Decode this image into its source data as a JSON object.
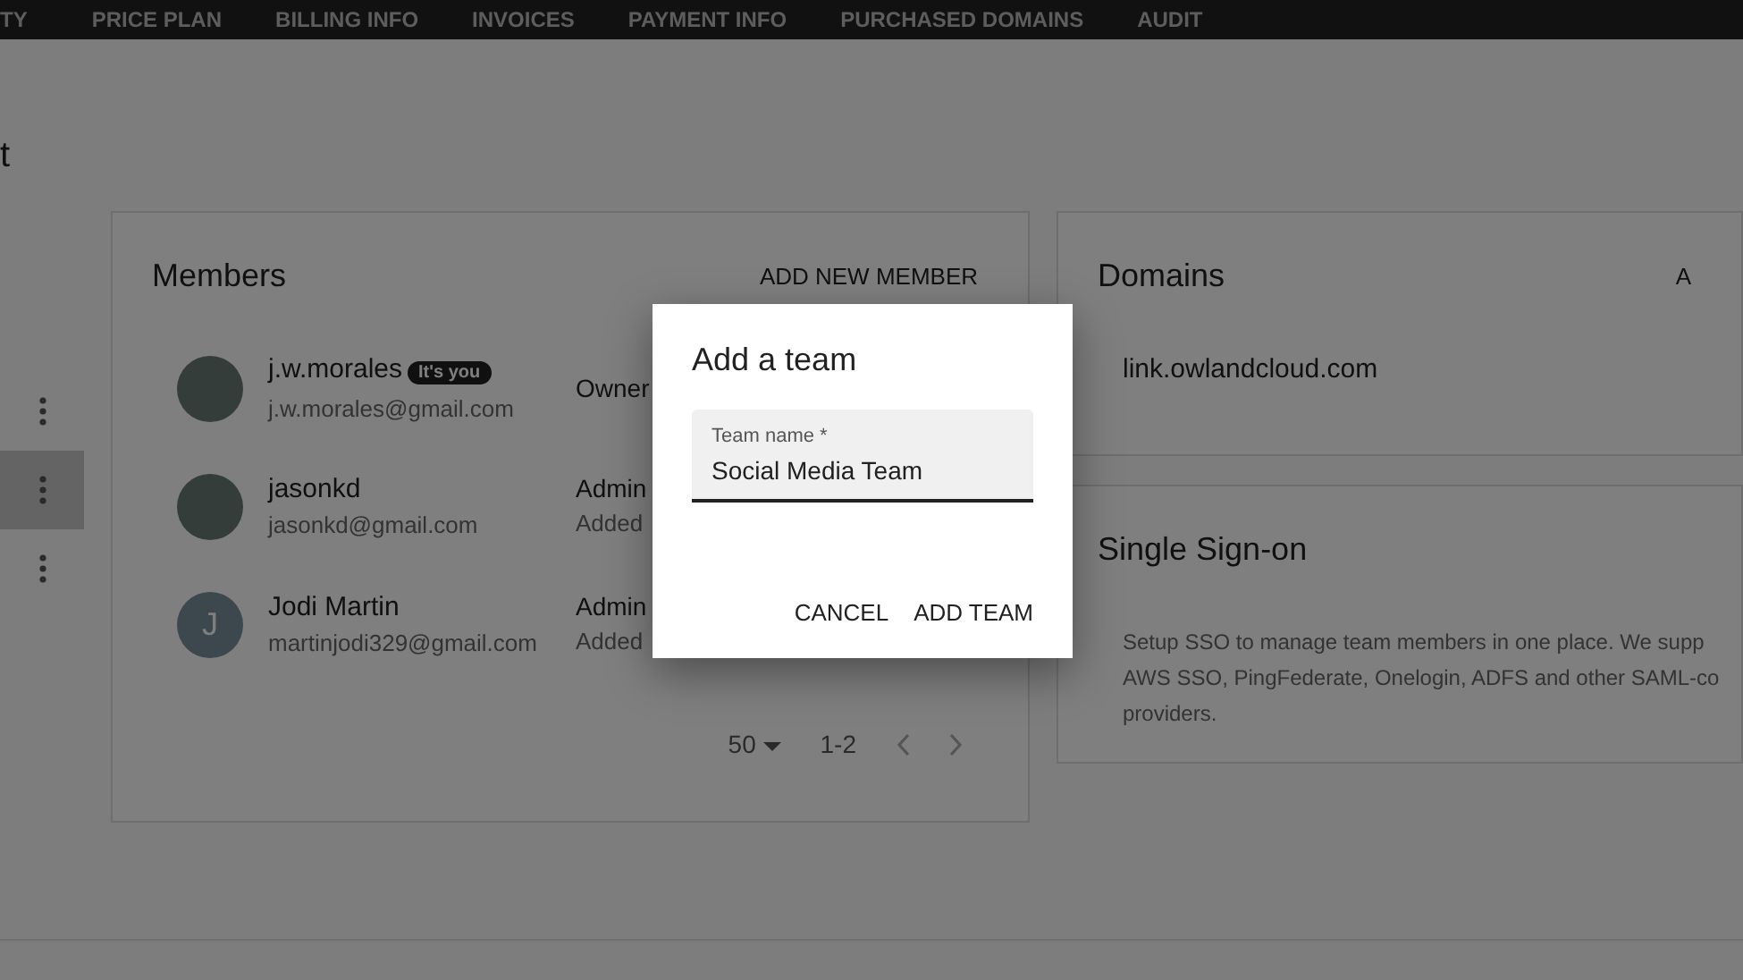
{
  "top_nav": {
    "items": [
      "TY",
      "PRICE PLAN",
      "BILLING INFO",
      "INVOICES",
      "PAYMENT INFO",
      "PURCHASED DOMAINS",
      "AUDIT"
    ]
  },
  "page_title": "t",
  "sidebar": {
    "items": [
      {
        "selected": false
      },
      {
        "selected": true
      },
      {
        "selected": false
      }
    ]
  },
  "members": {
    "title": "Members",
    "action": "ADD NEW MEMBER",
    "rows": [
      {
        "kind": "photo",
        "initial": "",
        "name": "j.w.morales",
        "badge": "It's you",
        "email": "j.w.morales@gmail.com",
        "role": "Owner",
        "added": ""
      },
      {
        "kind": "photo",
        "initial": "",
        "name": "jasonkd",
        "badge": "",
        "email": "jasonkd@gmail.com",
        "role": "Admin",
        "added": "Added"
      },
      {
        "kind": "letter",
        "initial": "J",
        "name": "Jodi Martin",
        "badge": "",
        "email": "martinjodi329@gmail.com",
        "role": "Admin",
        "added": "Added"
      }
    ],
    "pagination": {
      "page_size": "50",
      "range": "1-2"
    }
  },
  "domains": {
    "title": "Domains",
    "action": "A",
    "items": [
      "link.owlandcloud.com"
    ]
  },
  "sso": {
    "title": "Single Sign-on",
    "text": "Setup SSO to manage team members in one place. We supp\nAWS SSO, PingFederate, Onelogin, ADFS and other SAML-co\nproviders."
  },
  "dialog": {
    "title": "Add a team",
    "field": {
      "label": "Team name *",
      "value": "Social Media Team"
    },
    "buttons": [
      "CANCEL",
      "ADD TEAM"
    ]
  }
}
